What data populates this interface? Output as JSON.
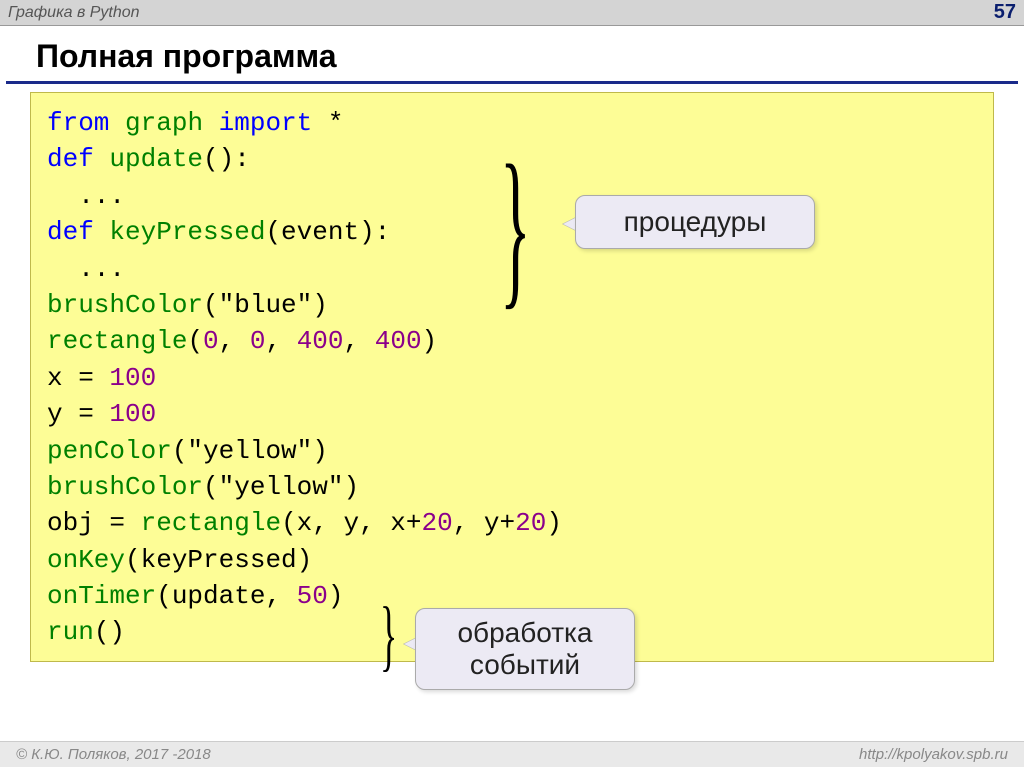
{
  "header": {
    "left": "Графика в Python",
    "page": "57"
  },
  "title": "Полная программа",
  "code": {
    "l1_from": "from",
    "l1_mod": "graph",
    "l1_import": "import",
    "l1_star": "*",
    "l2_def": "def",
    "l2_name": "update",
    "l2_tail": "():",
    "l3": "  ...",
    "l4_def": "def",
    "l4_name": "keyPressed",
    "l4_tail": "(event):",
    "l5": "  ...",
    "l6_fn": "brushColor",
    "l6_arg": "(\"blue\")",
    "l7_fn": "rectangle",
    "l7_open": "(",
    "l7_n1": "0",
    "l7_c1": ", ",
    "l7_n2": "0",
    "l7_c2": ", ",
    "l7_n3": "400",
    "l7_c3": ", ",
    "l7_n4": "400",
    "l7_close": ")",
    "l8_a": "x = ",
    "l8_n": "100",
    "l9_a": "y = ",
    "l9_n": "100",
    "l10_fn": "penColor",
    "l10_arg": "(\"yellow\")",
    "l11_fn": "brushColor",
    "l11_arg": "(\"yellow\")",
    "l12_a": "obj = ",
    "l12_fn": "rectangle",
    "l12_open": "(x, y, x+",
    "l12_n1": "20",
    "l12_mid": ", y+",
    "l12_n2": "20",
    "l12_close": ")",
    "l13_fn": "onKey",
    "l13_arg": "(keyPressed)",
    "l14_fn": "onTimer",
    "l14_open": "(update, ",
    "l14_n": "50",
    "l14_close": ")",
    "l15_fn": "run",
    "l15_tail": "()"
  },
  "annotations": {
    "procedures": "процедуры",
    "events_l1": "обработка",
    "events_l2": "событий"
  },
  "footer": {
    "left": "© К.Ю. Поляков, 2017 -2018",
    "right": "http://kpolyakov.spb.ru"
  }
}
